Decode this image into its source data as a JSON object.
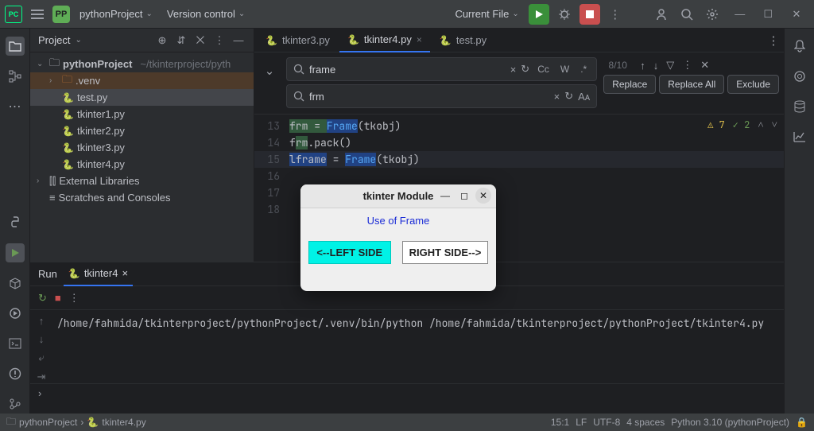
{
  "titlebar": {
    "project_badge": "PP",
    "project_name": "pythonProject",
    "vcs_menu": "Version control",
    "run_config": "Current File"
  },
  "project_panel": {
    "title": "Project",
    "root": {
      "name": "pythonProject",
      "path": "~/tkinterproject/pyth"
    },
    "items": [
      {
        "name": ".venv",
        "type": "folder-orange"
      },
      {
        "name": "test.py",
        "type": "py",
        "selected": true
      },
      {
        "name": "tkinter1.py",
        "type": "py"
      },
      {
        "name": "tkinter2.py",
        "type": "py"
      },
      {
        "name": "tkinter3.py",
        "type": "py"
      },
      {
        "name": "tkinter4.py",
        "type": "py"
      }
    ],
    "external_libs": "External Libraries",
    "scratches": "Scratches and Consoles"
  },
  "editor": {
    "tabs": [
      {
        "label": "tkinter3.py",
        "active": false
      },
      {
        "label": "tkinter4.py",
        "active": true
      },
      {
        "label": "test.py",
        "active": false
      }
    ],
    "search": {
      "find_value": "frame",
      "replace_value": "frm",
      "match_count": "8/10",
      "cc": "Cc",
      "word": "W",
      "regex": ".*",
      "replace_btn": "Replace",
      "replace_all_btn": "Replace All",
      "exclude_btn": "Exclude"
    },
    "lines": [
      {
        "n": "13",
        "pre": "frm = ",
        "fn": "Frame",
        "post": "(tkobj)"
      },
      {
        "n": "14",
        "pre": "frm.pack()",
        "fn": "",
        "post": ""
      },
      {
        "n": "15",
        "pre": "lframe = ",
        "fn": "Frame",
        "post": "(tkobj)"
      },
      {
        "n": "16",
        "pre": "",
        "fn": "",
        "post": ""
      },
      {
        "n": "17",
        "pre": "",
        "fn": "",
        "post": ""
      },
      {
        "n": "18",
        "pre": "",
        "fn": "",
        "post": ""
      }
    ],
    "inspection": {
      "warn": "7",
      "ok": "2"
    }
  },
  "run_panel": {
    "title": "Run",
    "tab_name": "tkinter4",
    "output": "/home/fahmida/tkinterproject/pythonProject/.venv/bin/python /home/fahmida/tkinterproject/pythonProject/tkinter4.py"
  },
  "statusbar": {
    "crumb_root": "pythonProject",
    "crumb_file": "tkinter4.py",
    "pos": "15:1",
    "line_end": "LF",
    "encoding": "UTF-8",
    "indent": "4 spaces",
    "interpreter": "Python 3.10 (pythonProject)"
  },
  "tk_window": {
    "title": "tkinter Module",
    "label": "Use of Frame",
    "left_btn": "<--LEFT SIDE",
    "right_btn": "RIGHT SIDE-->"
  }
}
